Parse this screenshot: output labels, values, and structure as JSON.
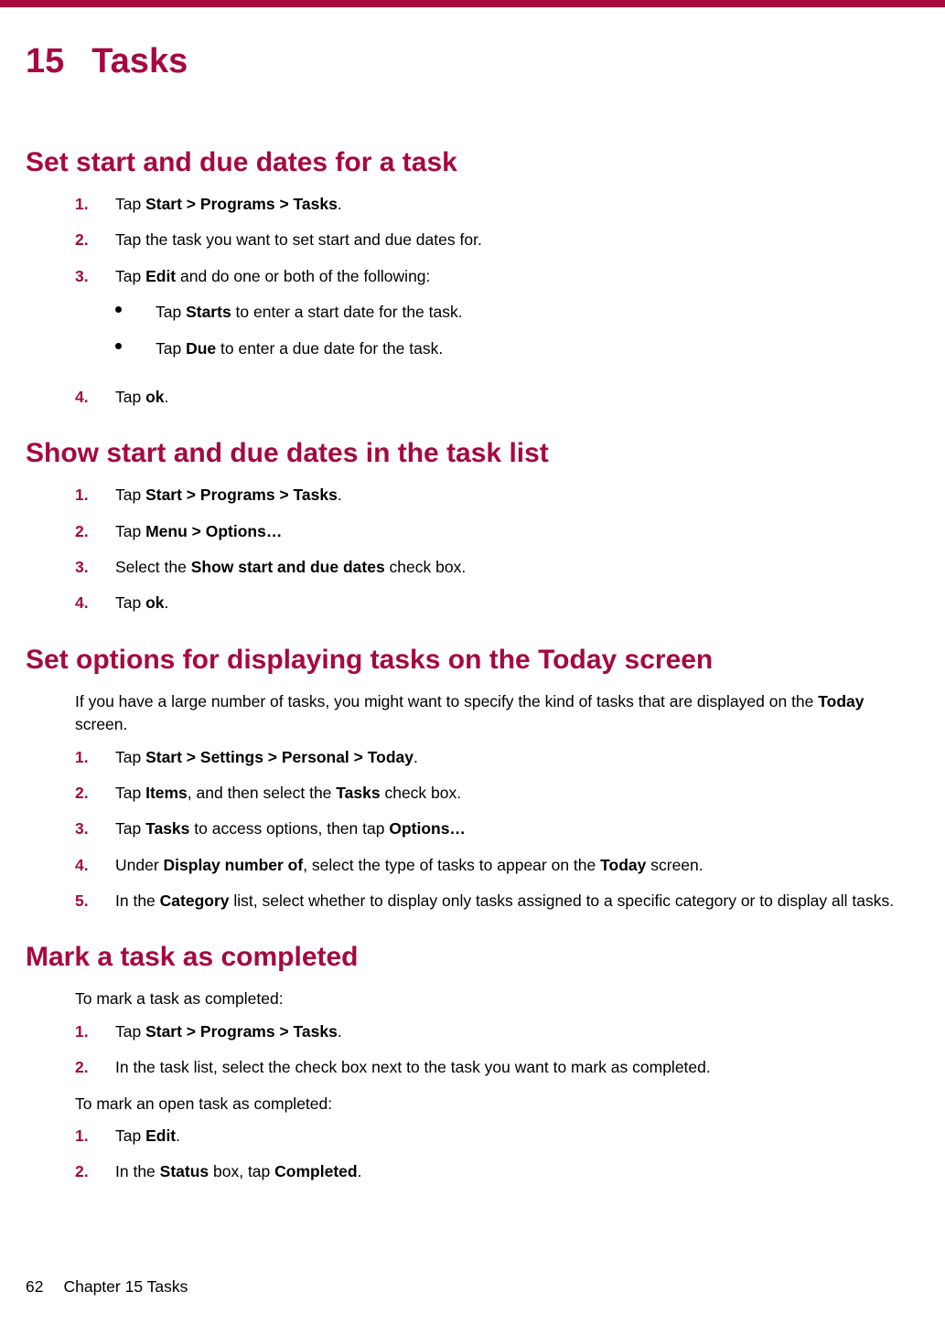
{
  "chapter": {
    "number": "15",
    "title": "Tasks"
  },
  "sections": {
    "s1": {
      "heading": "Set start and due dates for a task",
      "steps": [
        {
          "pre": "Tap ",
          "bold": "Start > Programs > Tasks",
          "post": "."
        },
        {
          "text": "Tap the task you want to set start and due dates for."
        },
        {
          "pre": "Tap ",
          "bold": "Edit",
          "post": " and do one or both of the following:",
          "sub": [
            {
              "pre": "Tap ",
              "bold": "Starts",
              "post": " to enter a start date for the task."
            },
            {
              "pre": "Tap ",
              "bold": "Due",
              "post": " to enter a due date for the task."
            }
          ]
        },
        {
          "pre": "Tap ",
          "bold": "ok",
          "post": "."
        }
      ]
    },
    "s2": {
      "heading": "Show start and due dates in the task list",
      "steps": [
        {
          "pre": "Tap ",
          "bold": "Start > Programs > Tasks",
          "post": "."
        },
        {
          "pre": "Tap ",
          "bold": "Menu > Options…",
          "post": ""
        },
        {
          "pre": "Select the ",
          "bold": "Show start and due dates",
          "post": " check box."
        },
        {
          "pre": "Tap ",
          "bold": "ok",
          "post": "."
        }
      ]
    },
    "s3": {
      "heading": "Set options for displaying tasks on the Today screen",
      "intro": {
        "pre": "If you have a large number of tasks, you might want to specify the kind of tasks that are displayed on the ",
        "bold": "Today",
        "post": " screen."
      },
      "steps": [
        {
          "pre": "Tap ",
          "bold": "Start > Settings > Personal > Today",
          "post": "."
        },
        {
          "pre": "Tap ",
          "bold": "Items",
          "mid": ", and then select the ",
          "bold2": "Tasks",
          "post": " check box."
        },
        {
          "pre": "Tap ",
          "bold": "Tasks",
          "mid": " to access options, then tap ",
          "bold2": "Options…",
          "post": ""
        },
        {
          "pre": "Under ",
          "bold": "Display number of",
          "mid": ", select the type of tasks to appear on the ",
          "bold2": "Today",
          "post": " screen."
        },
        {
          "pre": "In the ",
          "bold": "Category",
          "post": " list, select whether to display only tasks assigned to a specific category or to display all tasks."
        }
      ]
    },
    "s4": {
      "heading": "Mark a task as completed",
      "intro1": "To mark a task as completed:",
      "stepsA": [
        {
          "pre": "Tap ",
          "bold": "Start > Programs > Tasks",
          "post": "."
        },
        {
          "text": "In the task list, select the check box next to the task you want to mark as completed."
        }
      ],
      "intro2": "To mark an open task as completed:",
      "stepsB": [
        {
          "pre": "Tap ",
          "bold": "Edit",
          "post": "."
        },
        {
          "pre": "In the ",
          "bold": "Status",
          "mid": " box, tap ",
          "bold2": "Completed",
          "post": "."
        }
      ]
    }
  },
  "footer": {
    "page": "62",
    "label": "Chapter 15   Tasks"
  }
}
